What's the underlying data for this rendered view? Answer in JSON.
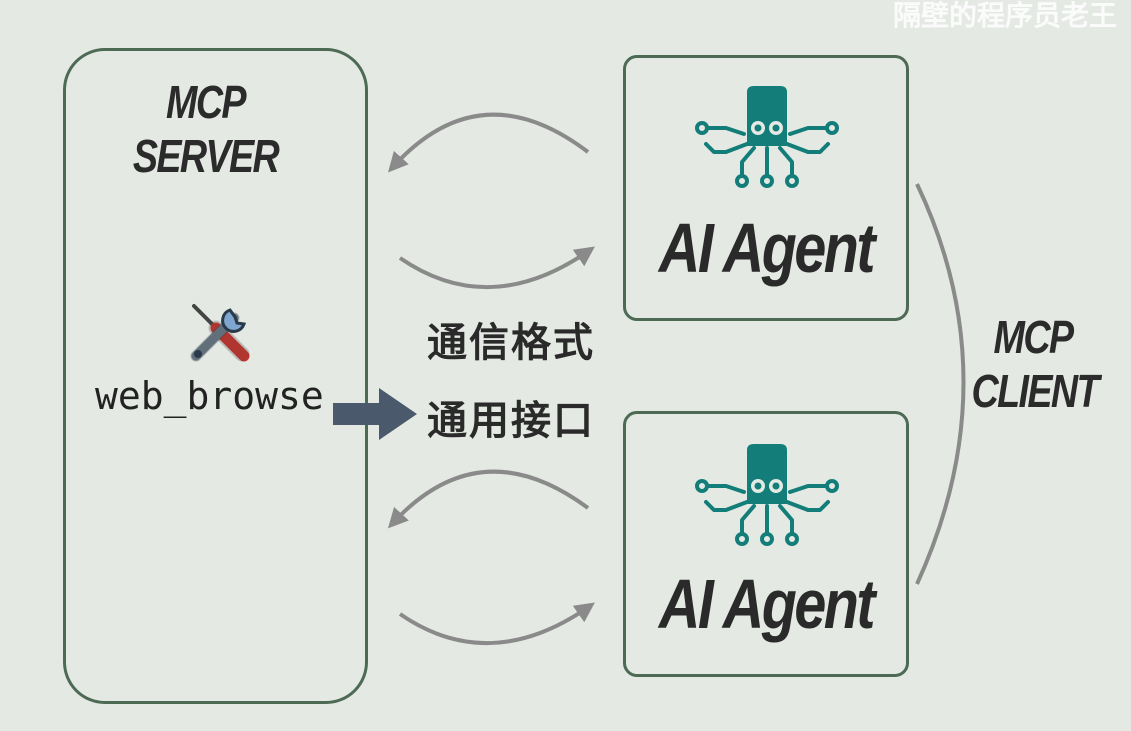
{
  "watermark": "隔壁的程序员老王",
  "server": {
    "title_line1": "MCP",
    "title_line2": "SERVER",
    "tool_icon": "hammer-wrench-icon",
    "tool_name": "web_browse"
  },
  "middle": {
    "line1": "通信格式",
    "line2": "通用接口"
  },
  "agents": [
    {
      "icon": "octopus-circuit-icon",
      "label": "AI Agent"
    },
    {
      "icon": "octopus-circuit-icon",
      "label": "AI Agent"
    }
  ],
  "client": {
    "title_line1": "MCP",
    "title_line2": "CLIENT"
  },
  "colors": {
    "background": "#e4e9e3",
    "box_border": "#4d6a55",
    "robot": "#127d79",
    "connector": "#8a8a8a",
    "arrow_block": "#4a5a6c"
  }
}
